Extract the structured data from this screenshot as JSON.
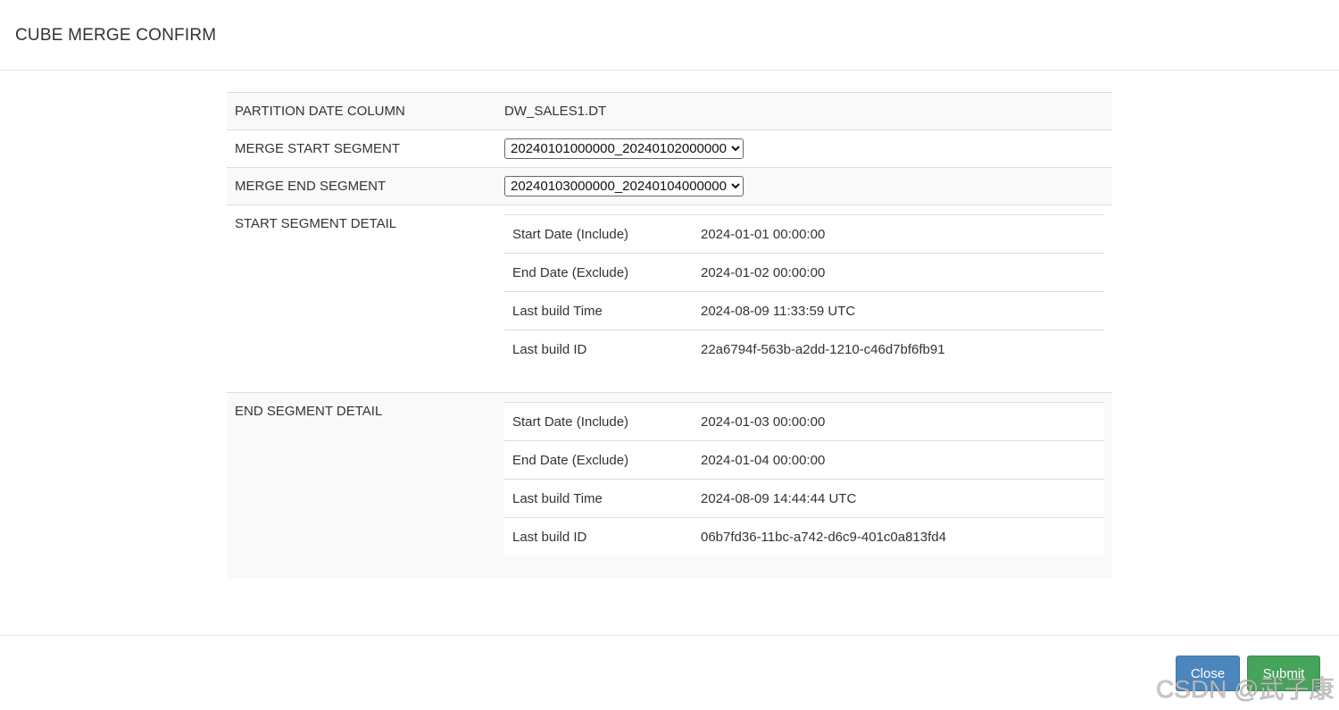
{
  "dialog": {
    "title": "CUBE MERGE CONFIRM"
  },
  "fields": {
    "partition_label": "PARTITION DATE COLUMN",
    "partition_value": "DW_SALES1.DT",
    "start_label": "MERGE START SEGMENT",
    "start_value": "20240101000000_20240102000000",
    "end_label": "MERGE END SEGMENT",
    "end_value": "20240103000000_20240104000000"
  },
  "start_detail": {
    "label": "START SEGMENT DETAIL",
    "rows": [
      {
        "k": "Start Date (Include)",
        "v": "2024-01-01 00:00:00"
      },
      {
        "k": "End Date (Exclude)",
        "v": "2024-01-02 00:00:00"
      },
      {
        "k": "Last build Time",
        "v": "2024-08-09 11:33:59 UTC"
      },
      {
        "k": "Last build ID",
        "v": "22a6794f-563b-a2dd-1210-c46d7bf6fb91"
      }
    ]
  },
  "end_detail": {
    "label": "END SEGMENT DETAIL",
    "rows": [
      {
        "k": "Start Date (Include)",
        "v": "2024-01-03 00:00:00"
      },
      {
        "k": "End Date (Exclude)",
        "v": "2024-01-04 00:00:00"
      },
      {
        "k": "Last build Time",
        "v": "2024-08-09 14:44:44 UTC"
      },
      {
        "k": "Last build ID",
        "v": "06b7fd36-11bc-a742-d6c9-401c0a813fd4"
      }
    ]
  },
  "buttons": {
    "close": "Close",
    "submit": "Submit"
  },
  "watermark": "CSDN @武子康"
}
